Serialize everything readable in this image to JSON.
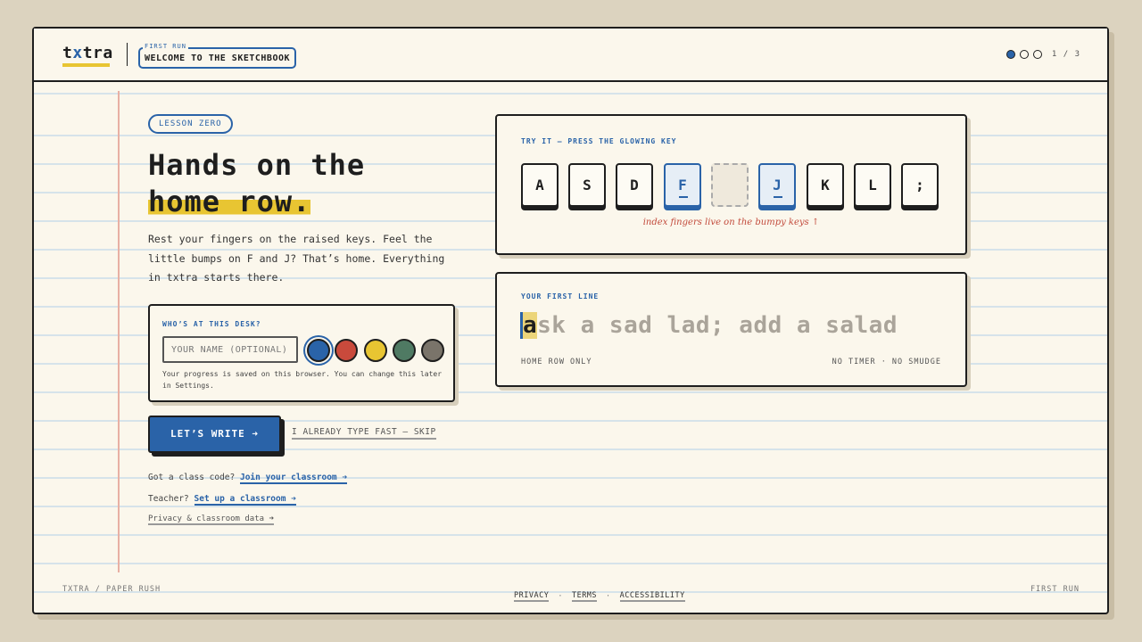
{
  "header": {
    "logo_prefix": "t",
    "logo_accent": "x",
    "logo_suffix": "tra",
    "kicker": "FIRST RUN",
    "title": "WELCOME TO THE SKETCHBOOK",
    "progress": {
      "current": 1,
      "total": 3,
      "label": "1 / 3"
    }
  },
  "intro": {
    "pill": "LESSON ZERO",
    "headline_line1": "Hands on the",
    "headline_line2": "home row.",
    "body": "Rest your fingers on the raised keys. Feel the little bumps on F and J? That’s home. Everything in txtra starts there."
  },
  "name_card": {
    "label": "WHO’S AT THIS DESK?",
    "placeholder": "YOUR NAME (OPTIONAL)",
    "value": "",
    "colors": [
      "#2a63a8",
      "#c94a3c",
      "#e8c532",
      "#4f7a63",
      "#7a746a"
    ],
    "selected_color": 0,
    "note": "Your progress is saved on this browser. You can change this later in Settings."
  },
  "actions": {
    "primary": "LET’S WRITE ➜",
    "skip": "I ALREADY TYPE FAST — SKIP"
  },
  "links": {
    "class_prompt": "Got a class code?",
    "class_link": "Join your classroom ➜",
    "teacher_prompt": "Teacher?",
    "teacher_link": "Set up a classroom ➜",
    "privacy": "Privacy & classroom data ➜"
  },
  "try_it": {
    "label": "TRY IT — PRESS THE GLOWING KEY",
    "keys": [
      "A",
      "S",
      "D",
      "F",
      "",
      "J",
      "K",
      "L",
      ";"
    ],
    "hint": "index fingers live on the bumpy keys ↑"
  },
  "first_line": {
    "label": "YOUR FIRST LINE",
    "current_char": "a",
    "remaining_text": "sk a sad lad; add a salad",
    "meta_left": "HOME ROW ONLY",
    "meta_right": "NO TIMER · NO SMUDGE"
  },
  "footer": {
    "left": "TXTRA / PAPER RUSH",
    "links": [
      "PRIVACY",
      "TERMS",
      "ACCESSIBILITY"
    ],
    "separator": "·",
    "right": "FIRST RUN"
  }
}
